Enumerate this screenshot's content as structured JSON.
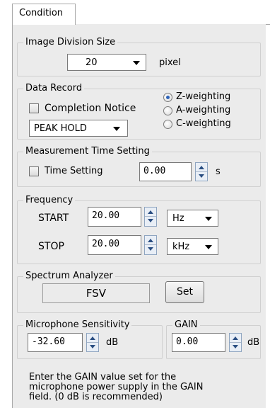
{
  "tab": {
    "label": "Condition"
  },
  "image_division": {
    "title": "Image Division Size",
    "value": "20",
    "unit": "pixel"
  },
  "data_record": {
    "title": "Data Record",
    "completion_notice": {
      "label": "Completion Notice",
      "checked": false
    },
    "mode": "PEAK HOLD",
    "weighting": [
      {
        "label": "Z-weighting",
        "selected": true
      },
      {
        "label": "A-weighting",
        "selected": false
      },
      {
        "label": "C-weighting",
        "selected": false
      }
    ]
  },
  "measurement_time": {
    "title": "Measurement Time Setting",
    "checkbox_label": "Time Setting",
    "checked": false,
    "value": "0.00",
    "unit": "s"
  },
  "frequency": {
    "title": "Frequency",
    "start": {
      "label": "START",
      "value": "20.00",
      "unit": "Hz"
    },
    "stop": {
      "label": "STOP",
      "value": "20.00",
      "unit": "kHz"
    }
  },
  "spectrum_analyzer": {
    "title": "Spectrum Analyzer",
    "display": "FSV",
    "set_label": "Set"
  },
  "mic_sensitivity": {
    "title": "Microphone Sensitivity",
    "value": "-32.60",
    "unit": "dB"
  },
  "gain": {
    "title": "GAIN",
    "value": "0.00",
    "unit": "dB"
  },
  "help_text": "Enter the GAIN value set for the\nmicrophone power supply in the GAIN\nfield. (0 dB is recommended)"
}
